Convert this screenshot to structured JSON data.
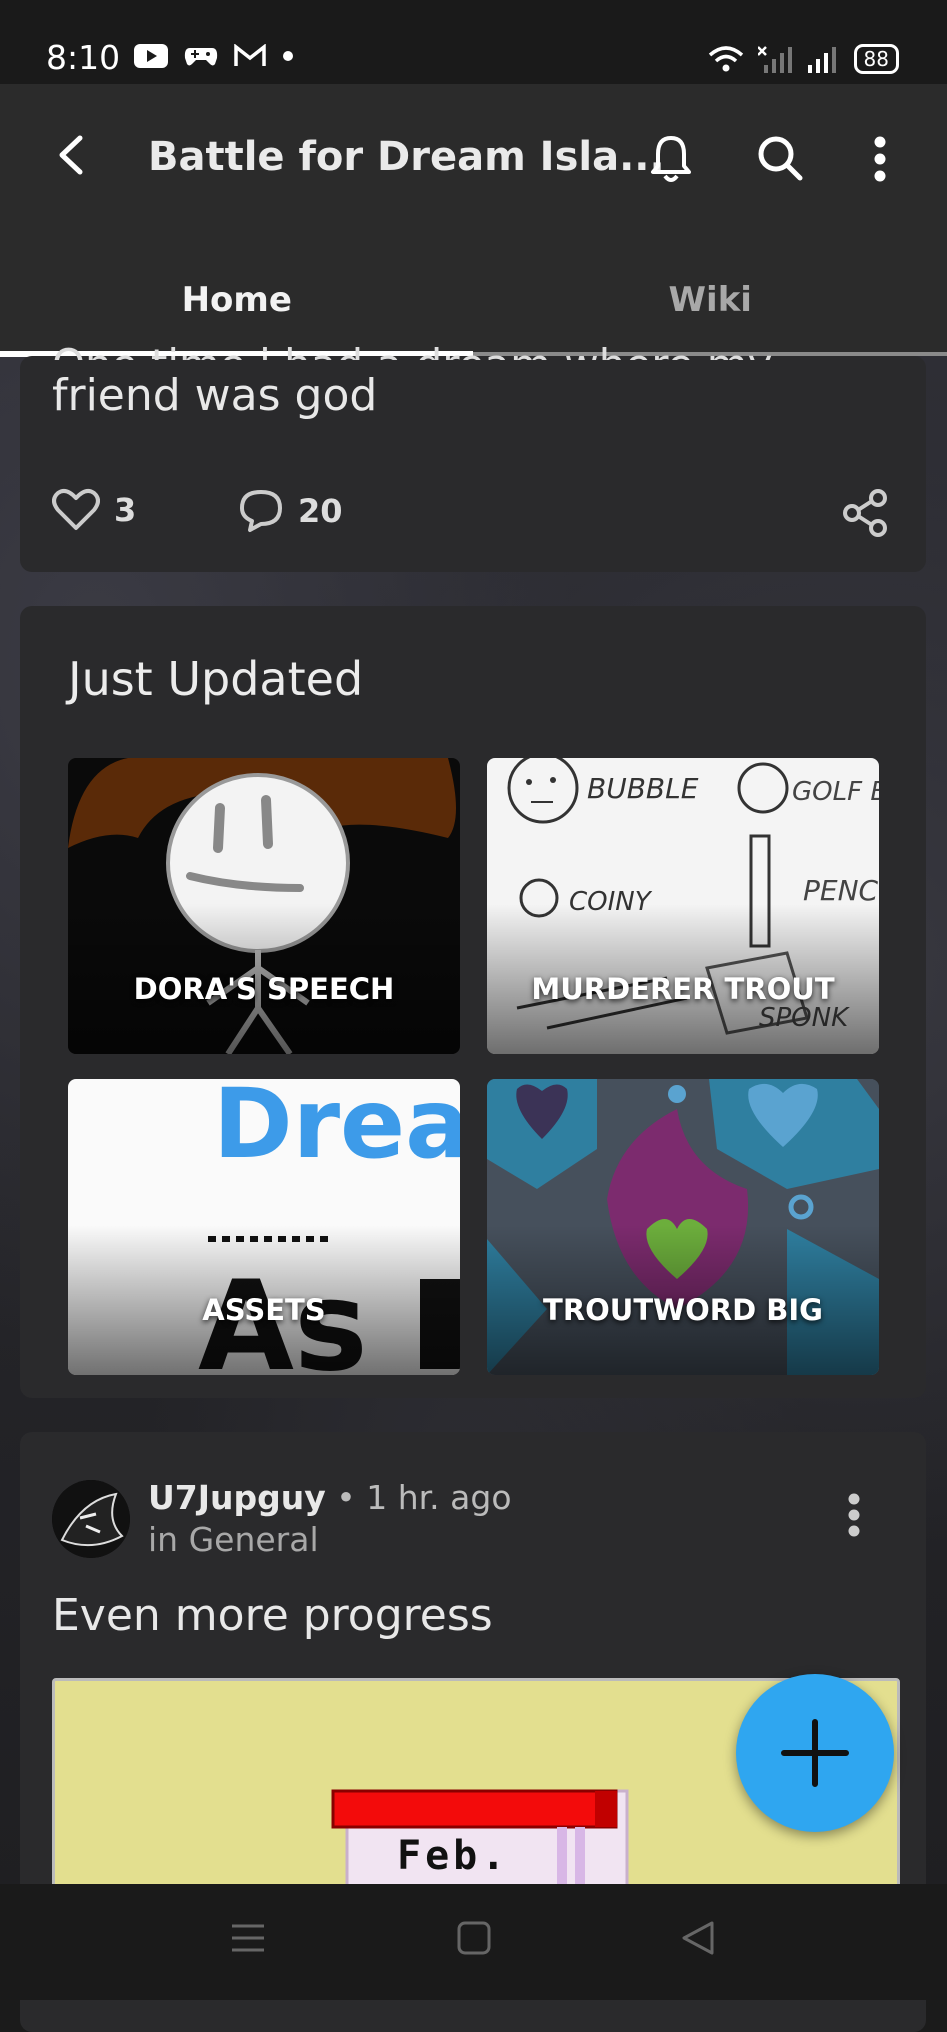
{
  "status_bar": {
    "time": "8:10",
    "battery": "88",
    "icons": [
      "youtube-icon",
      "gamepad-icon",
      "gmail-icon",
      "dot-icon",
      "wifi-icon",
      "signal-icon",
      "signal-icon"
    ]
  },
  "app_bar": {
    "title": "Battle for Dream Isla...",
    "tabs": [
      {
        "label": "Home",
        "active": true
      },
      {
        "label": "Wiki",
        "active": false
      }
    ]
  },
  "top_post": {
    "clipped_line": "One time i had a dream where my",
    "text": "friend was god",
    "likes": "3",
    "comments": "20"
  },
  "just_updated": {
    "title": "Just Updated",
    "items": [
      {
        "label": "DORA'S SPEECH"
      },
      {
        "label": "MURDERER TROUT"
      },
      {
        "label": "ASSETS"
      },
      {
        "label": "TROUTWORD BIG"
      }
    ]
  },
  "post": {
    "author": "U7Jupguy",
    "time": "• 1 hr. ago",
    "community": "in General",
    "title": "Even more progress",
    "image_text": "Feb."
  },
  "colors": {
    "accent": "#2fa6f0",
    "card": "#2a2a2c",
    "appbar": "#2b2b2b"
  }
}
